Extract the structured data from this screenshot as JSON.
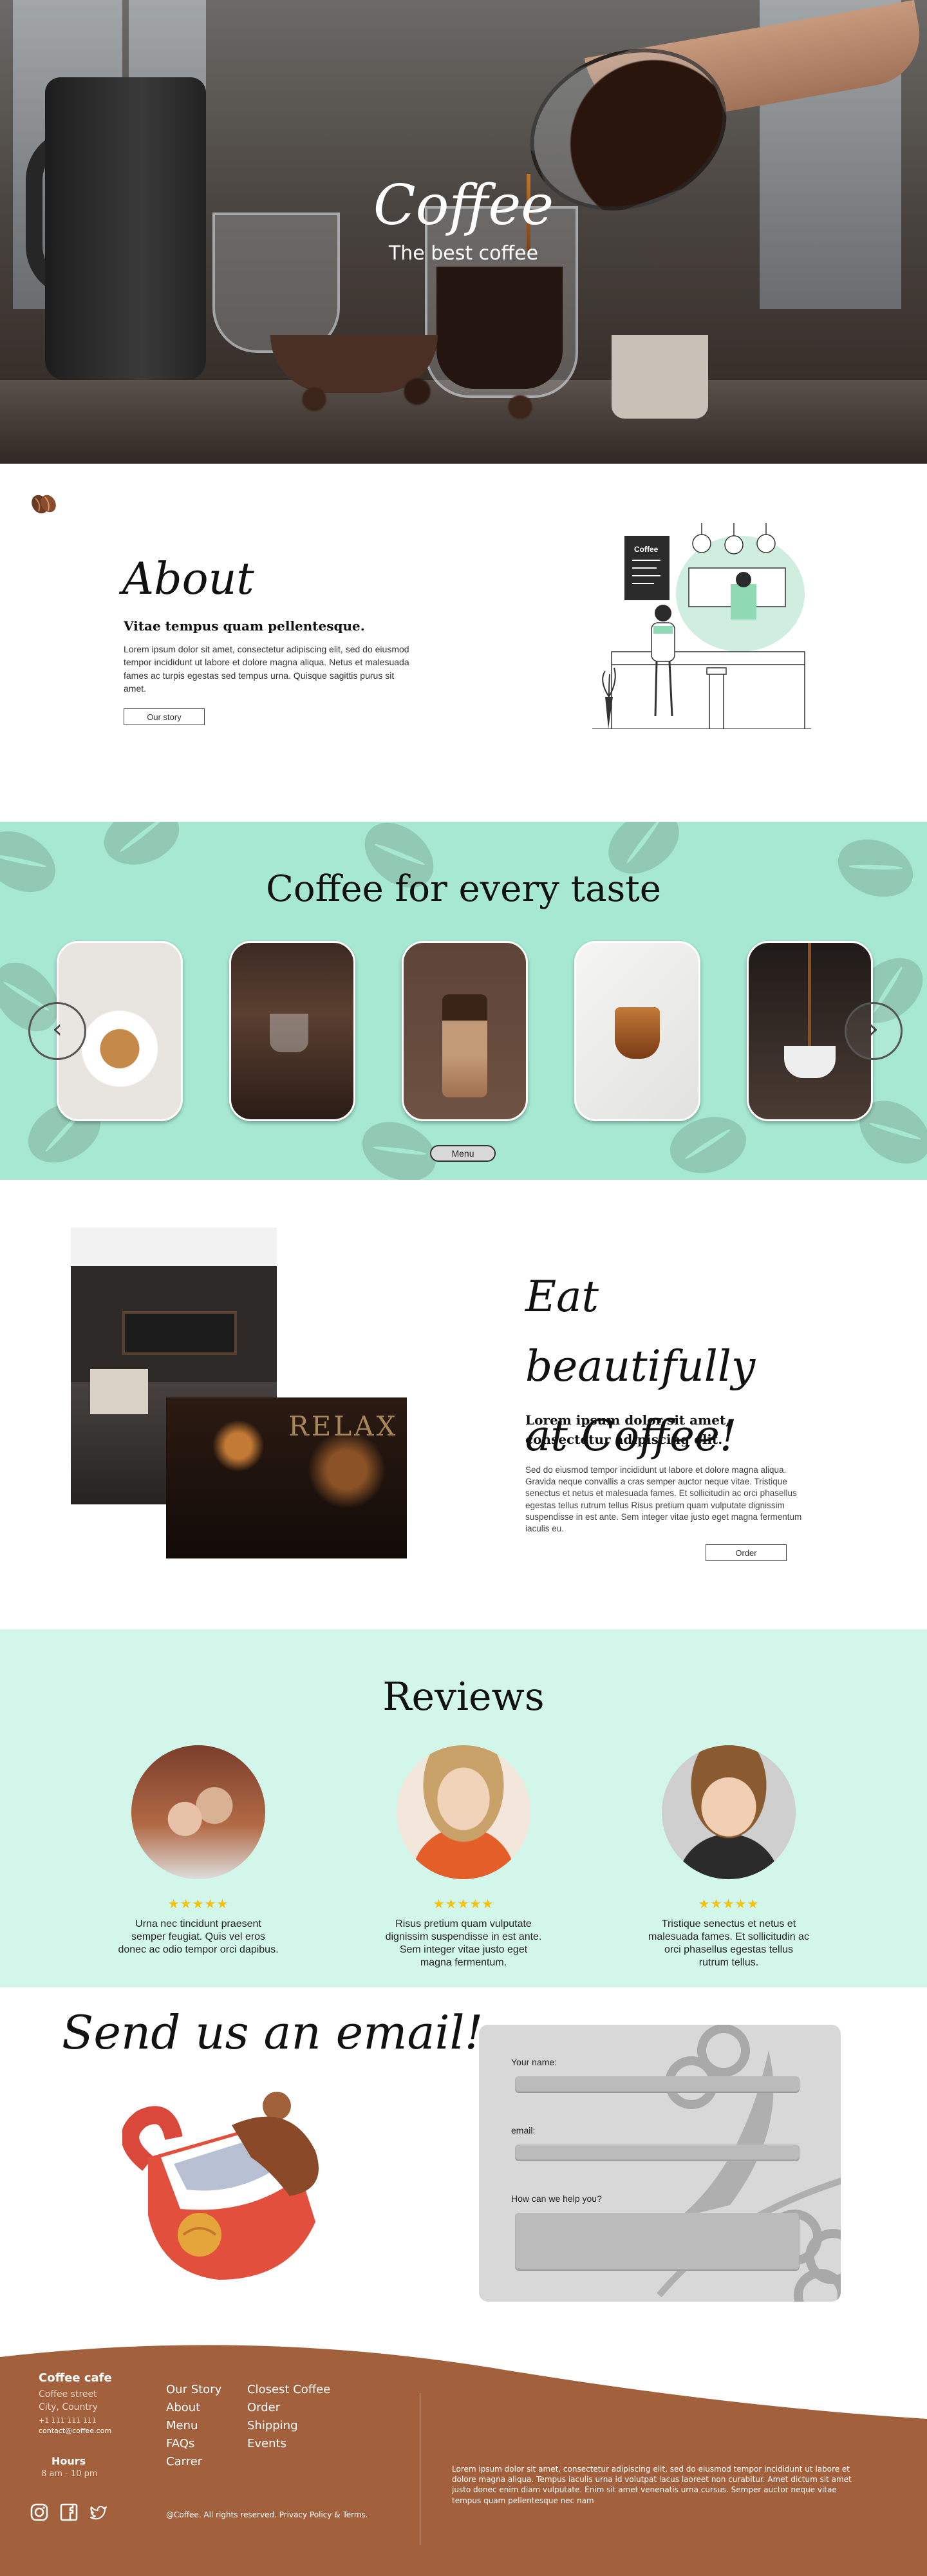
{
  "hero": {
    "title": "Coffee",
    "subtitle": "The best coffee"
  },
  "about": {
    "title": "About",
    "subtitle": "Vitae tempus quam pellentesque.",
    "body": "Lorem ipsum dolor sit amet, consectetur adipiscing elit, sed do eiusmod tempor incididunt ut labore et dolore magna aliqua. Netus et malesuada fames ac turpis egestas sed tempus urna. Quisque sagittis purus sit amet.",
    "button": "Our story"
  },
  "taste": {
    "title": "Coffee for every taste",
    "prev_icon": "chevron-left-icon",
    "next_icon": "chevron-right-icon",
    "menu_button": "Menu",
    "background_color": "#a6e8d2"
  },
  "eat": {
    "title_line1": "Eat beautifully",
    "title_line2": "at Coffee!",
    "subtitle": "Lorem ipsum dolor sit amet, consectetur adipiscing elit.",
    "body": "Sed do eiusmod tempor incididunt ut labore et dolore magna aliqua. Gravida neque convallis a cras semper auctor neque vitae. Tristique senectus et netus et malesuada fames. Et sollicitudin ac orci phasellus egestas tellus rutrum tellus Risus pretium quam vulputate dignissim suspendisse in est ante. Sem integer vitae justo eget magna fermentum iaculis eu.",
    "button": "Order"
  },
  "reviews": {
    "title": "Reviews",
    "background_color": "#d2f7ea",
    "items": [
      {
        "stars": 5,
        "stars_text": "★★★★★",
        "text": "Urna nec tincidunt praesent semper feugiat. Quis vel eros donec ac odio tempor orci dapibus."
      },
      {
        "stars": 5,
        "stars_text": "★★★★★",
        "text": "Risus pretium quam vulputate dignissim suspendisse in est ante. Sem integer vitae justo eget magna fermentum."
      },
      {
        "stars": 5,
        "stars_text": "★★★★★",
        "text": "Tristique senectus et netus et malesuada fames. Et sollicitudin ac orci phasellus egestas tellus rutrum tellus."
      }
    ]
  },
  "email": {
    "title": "Send us an email!",
    "form": {
      "name_label": "Your name:",
      "email_label": "email:",
      "help_label": "How can we help you?"
    }
  },
  "footer": {
    "brand": "Coffee cafe",
    "address_line1": "Coffee street",
    "address_line2": "City, Country",
    "phone": "+1 111 111 111",
    "contact_email": "contact@coffee.com",
    "hours_title": "Hours",
    "hours_value": "8 am - 10 pm",
    "links_col1": [
      "Our Story",
      "About",
      "Menu",
      "FAQs",
      "Carrer"
    ],
    "links_col2": [
      "Closest Coffee",
      "Order",
      "Shipping",
      "Events"
    ],
    "text": "Lorem ipsum dolor sit amet, consectetur adipiscing elit, sed do eiusmod tempor incididunt ut labore et dolore magna aliqua. Tempus iaculis urna id volutpat lacus laoreet non curabitur. Amet dictum sit amet justo donec enim diam vulputate. Enim sit amet venenatis urna cursus. Semper auctor neque vitae tempus quam pellentesque nec nam",
    "copyright": "@Coffee. All rights reserved. Privacy Policy & Terms.",
    "social_icons": [
      "instagram-icon",
      "facebook-icon",
      "twitter-icon"
    ],
    "color": "#a2603d"
  }
}
